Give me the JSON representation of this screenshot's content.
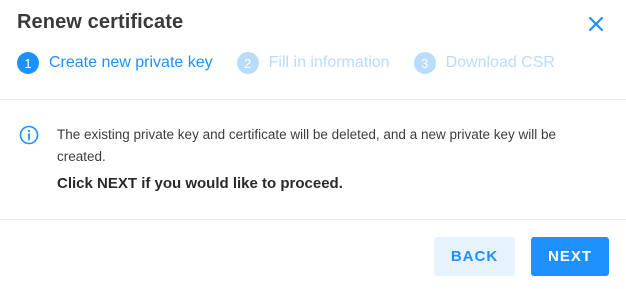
{
  "dialog": {
    "title": "Renew certificate",
    "close_icon": "close-icon"
  },
  "steps": [
    {
      "number": "1",
      "label": "Create new private key",
      "state": "active"
    },
    {
      "number": "2",
      "label": "Fill in information",
      "state": "inactive"
    },
    {
      "number": "3",
      "label": "Download CSR",
      "state": "inactive"
    }
  ],
  "body": {
    "info_icon": "info-icon",
    "info_text": "The existing private key and certificate will be deleted, and a new private key will be created.",
    "proceed_text": "Click NEXT if you would like to proceed."
  },
  "footer": {
    "back_label": "BACK",
    "next_label": "NEXT"
  },
  "colors": {
    "accent": "#1e90ff",
    "accent_light": "#b9dcfb",
    "back_bg": "#e6f3fd"
  }
}
